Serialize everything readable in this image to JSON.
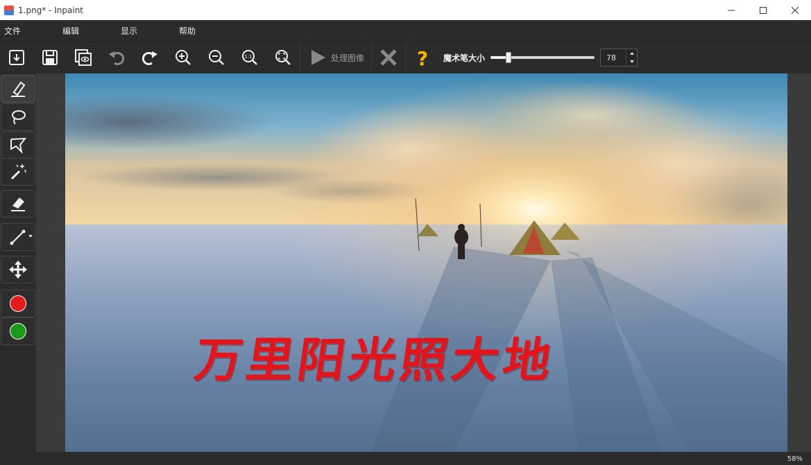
{
  "window": {
    "title": "1.png* - Inpaint"
  },
  "menu": {
    "items": [
      {
        "label": "文件"
      },
      {
        "label": "编辑"
      },
      {
        "label": "显示"
      },
      {
        "label": "帮助"
      }
    ]
  },
  "toolbar": {
    "buttons": [
      "open-icon",
      "save-icon",
      "preview-icon",
      "undo-icon",
      "redo-icon",
      "zoom-in-icon",
      "zoom-out-icon",
      "actual-size-icon",
      "fit-to-window-icon"
    ],
    "process_label": "处理图像",
    "cancel_icon": "close-icon",
    "help_icon": "question-icon",
    "brush_size_label": "魔术笔大小",
    "brush_size_value": "78",
    "brush_size_fraction": 0.17
  },
  "tools": {
    "items": [
      "marker-icon",
      "lasso-icon",
      "polygonal-lasso-icon",
      "magic-wand-icon",
      "eraser-icon",
      "line-icon",
      "move-icon"
    ],
    "active": "marker-icon",
    "colors": {
      "primary": "#e31b1b",
      "secondary": "#1a9a1a"
    }
  },
  "canvas": {
    "overlay_text": "万里阳光照大地"
  },
  "status": {
    "zoom": "58%"
  }
}
